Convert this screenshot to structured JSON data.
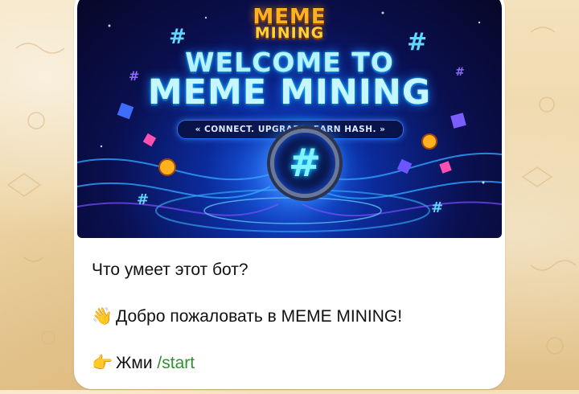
{
  "banner": {
    "logo_line1": "MEME",
    "logo_line2": "MINING",
    "headline_line1": "WELCOME TO",
    "headline_line2": "MEME MINING",
    "tagline": "« CONNECT. UPGRADE. EARN HASH. »",
    "center_symbol": "#"
  },
  "message": {
    "question": "Что умеет этот бот?",
    "welcome_emoji": "👋",
    "welcome_text": "Добро пожаловать в MEME MINING!",
    "start_emoji": "👉",
    "start_prefix": "Жми",
    "start_command": "/start"
  },
  "colors": {
    "command_link": "#2f8f2f",
    "bubble_background": "#ffffff",
    "wallpaper": "#ecd3a3"
  }
}
